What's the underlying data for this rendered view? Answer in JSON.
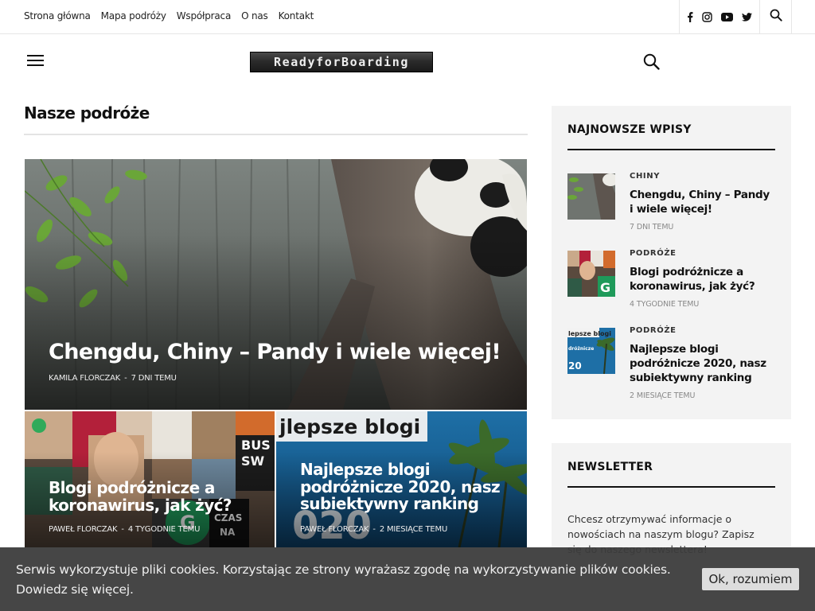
{
  "topbar": {
    "nav": [
      "Strona główna",
      "Mapa podróży",
      "Współpraca",
      "O nas",
      "Kontakt"
    ],
    "social_icons": [
      "facebook-icon",
      "instagram-icon",
      "youtube-icon",
      "twitter-icon"
    ],
    "search_icon": "search-icon"
  },
  "header": {
    "menu_icon": "hamburger-icon",
    "logo_text": "ReadyforBoarding",
    "search_icon": "search-icon"
  },
  "main": {
    "section_title": "Nasze podróże",
    "featured": {
      "title": "Chengdu, Chiny – Pandy i wiele więcej!",
      "author": "KAMILA FLORCZAK",
      "sep": "-",
      "date": "7 DNI TEMU"
    },
    "cards": [
      {
        "title": "Blogi podróżnicze a koronawirus, jak żyć?",
        "author": "PAWEŁ FLORCZAK",
        "sep": "-",
        "date": "4 TYGODNIE TEMU"
      },
      {
        "title": "Najlepsze blogi podróżnicze 2020, nasz subiektywny ranking",
        "author": "PAWEŁ FLORCZAK",
        "sep": "-",
        "date": "2 MIESIĄCE TEMU",
        "image_text": "jlepsze blogi"
      }
    ]
  },
  "sidebar": {
    "recent": {
      "heading": "NAJNOWSZE WPISY",
      "posts": [
        {
          "category": "CHINY",
          "title": "Chengdu, Chiny – Pandy i wiele więcej!",
          "date": "7 DNI TEMU"
        },
        {
          "category": "PODRÓŻE",
          "title": "Blogi podróżnicze a koronawirus, jak żyć?",
          "date": "4 TYGODNIE TEMU"
        },
        {
          "category": "PODRÓŻE",
          "title": "Najlepsze blogi podróżnicze 2020, nasz subiektywny ranking",
          "date": "2 MIESIĄCE TEMU"
        }
      ]
    },
    "newsletter": {
      "heading": "NEWSLETTER",
      "text": "Chcesz otrzymywać informacje o nowościach na naszym blogu? Zapisz się do naszego newslettera!"
    }
  },
  "cookie": {
    "text": "Serwis wykorzystuje pliki cookies. Korzystając ze strony wyrażasz zgodę na wykorzystywanie plików cookies.",
    "link": "Dowiedz się więcej.",
    "button": "Ok, rozumiem"
  },
  "colors": {
    "text": "#111111",
    "sidebar_bg": "#f3f3f3",
    "cookie_bg": "#3c3c3c",
    "cookie_button_bg": "#dddddd"
  }
}
